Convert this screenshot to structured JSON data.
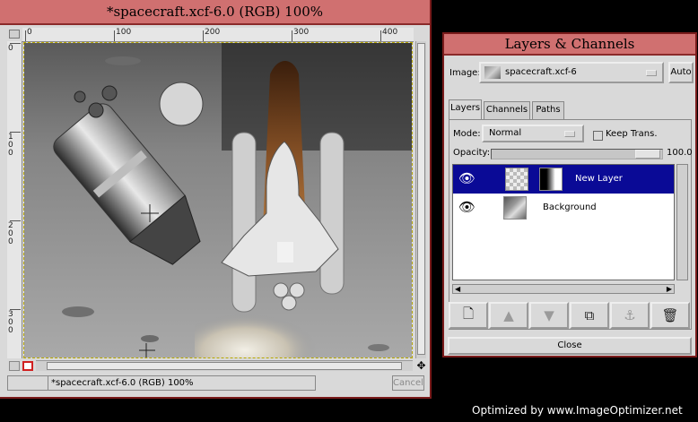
{
  "image_window": {
    "title": "*spacecraft.xcf-6.0 (RGB) 100%",
    "ruler_h_labels": [
      "0",
      "100",
      "200",
      "300",
      "400"
    ],
    "ruler_v_labels": [
      "0",
      "100",
      "200",
      "300"
    ],
    "status_text": "*spacecraft.xcf-6.0 (RGB) 100%",
    "cancel_label": "Cancel"
  },
  "layers_window": {
    "title": "Layers & Channels",
    "image_label": "Image:",
    "image_value": "spacecraft.xcf-6",
    "auto_label": "Auto",
    "tabs": [
      {
        "label": "Layers",
        "active": true
      },
      {
        "label": "Channels",
        "active": false
      },
      {
        "label": "Paths",
        "active": false
      }
    ],
    "mode_label": "Mode:",
    "mode_value": "Normal",
    "keep_trans_label": "Keep Trans.",
    "opacity_label": "Opacity:",
    "opacity_value": "100.0",
    "opacity_fraction": 1.0,
    "layers": [
      {
        "name": "New Layer",
        "visible": true,
        "selected": true,
        "has_mask": true
      },
      {
        "name": "Background",
        "visible": true,
        "selected": false,
        "has_mask": false
      }
    ],
    "close_label": "Close",
    "toolbar_icons": [
      "new-layer-icon",
      "raise-layer-icon",
      "lower-layer-icon",
      "duplicate-layer-icon",
      "anchor-layer-icon",
      "delete-layer-icon"
    ]
  },
  "watermark": "Optimized by www.ImageOptimizer.net",
  "colors": {
    "title_bar": "#d07070",
    "selection": "#0a0a96",
    "window_bg": "#d9d9d9"
  }
}
